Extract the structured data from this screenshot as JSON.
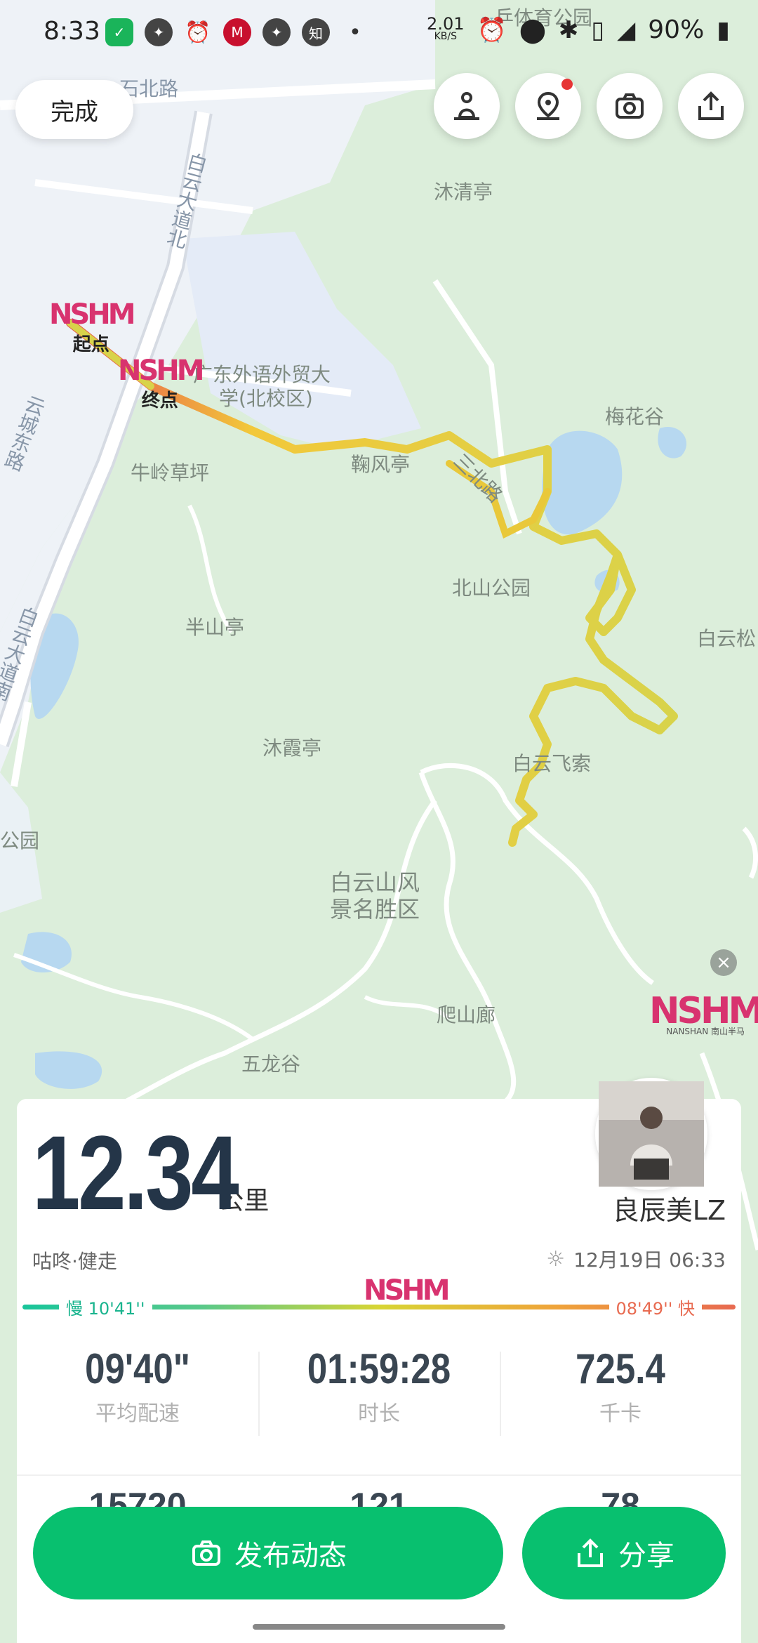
{
  "status_bar": {
    "time": "8:33",
    "net_rate_value": "2.01",
    "net_rate_unit": "KB/S",
    "battery": "90%",
    "icons": [
      "wechat-icon",
      "app-icon",
      "alarm-icon",
      "metro-icon",
      "app-icon",
      "zhihu-icon",
      "dot-icon",
      "alarm-icon",
      "location-icon",
      "bluetooth-icon",
      "vibrate-icon",
      "signal-4g-icon",
      "battery-icon"
    ]
  },
  "toolbar": {
    "done_label": "完成",
    "icons": [
      "meditation-icon",
      "location-pin-icon",
      "camera-icon",
      "share-icon"
    ]
  },
  "map": {
    "labels": [
      "石北路",
      "白云大道北",
      "沐清亭",
      "广东外语外贸大",
      "学(北校区)",
      "梅花谷",
      "云城东路",
      "牛岭草坪",
      "鞠风亭",
      "三北路",
      "北山公园",
      "半山亭",
      "白云松",
      "白云大道南",
      "沐霞亭",
      "白云飞索",
      "公园",
      "白云山风",
      "景名胜区",
      "爬山廊",
      "五龙谷",
      "乒体育公园"
    ],
    "start_label": "起点",
    "end_label": "终点",
    "logo_text": "NSHM",
    "watermark_text": "NANSHAN 南山半马"
  },
  "summary": {
    "distance_value": "12.34",
    "distance_unit": "公里",
    "username": "良辰美LZ",
    "activity": "咕咚·健走",
    "datetime": "12月19日 06:33",
    "pace_slow": "慢 10'41''",
    "pace_fast": "08'49'' 快",
    "stats": [
      {
        "value": "09'40\"",
        "label": "平均配速"
      },
      {
        "value": "01:59:28",
        "label": "时长"
      },
      {
        "value": "725.4",
        "label": "千卡"
      }
    ],
    "stats_partial": [
      "15720",
      "121",
      "78"
    ]
  },
  "actions": {
    "publish_label": "发布动态",
    "share_label": "分享"
  },
  "colors": {
    "accent": "#08c06f",
    "route_start": "#e86a50",
    "route_main": "#f2c83a",
    "route_end": "#d8d34a"
  }
}
